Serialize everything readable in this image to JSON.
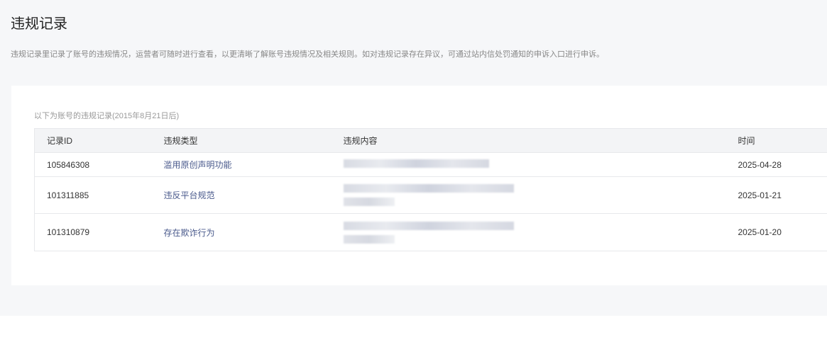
{
  "page": {
    "title": "违规记录",
    "description": "违规记录里记录了账号的违规情况，运营者可随时进行查看，以更清晰了解账号违规情况及相关规则。如对违规记录存在异议，可通过站内信处罚通知的申诉入口进行申诉。"
  },
  "records": {
    "subtitle": "以下为账号的违规记录(2015年8月21日后)",
    "headers": [
      "记录ID",
      "违规类型",
      "违规内容",
      "时间"
    ],
    "rows": [
      {
        "id": "105846308",
        "type": "滥用原创声明功能",
        "time": "2025-04-28"
      },
      {
        "id": "101311885",
        "type": "违反平台规范",
        "time": "2025-01-21"
      },
      {
        "id": "101310879",
        "type": "存在欺诈行为",
        "time": "2025-01-20"
      }
    ]
  }
}
